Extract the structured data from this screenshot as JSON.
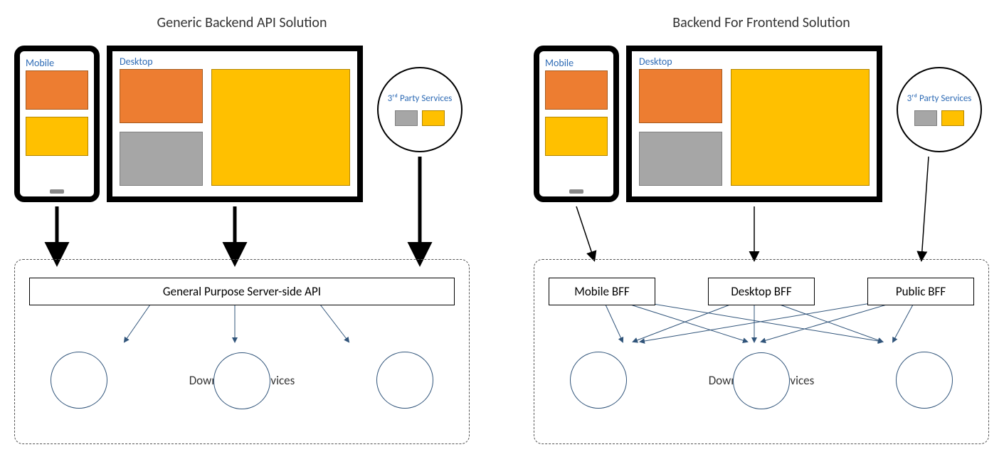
{
  "left": {
    "title": "Generic Backend API Solution",
    "mobile_label": "Mobile",
    "desktop_label": "Desktop",
    "third_party_label": "3ʳᵈ Party Services",
    "api_label": "General Purpose Server-side API",
    "downstream_label": "Downstream Services"
  },
  "right": {
    "title": "Backend For Frontend Solution",
    "mobile_label": "Mobile",
    "desktop_label": "Desktop",
    "third_party_label": "3ʳᵈ Party Services",
    "bff1": "Mobile BFF",
    "bff2": "Desktop BFF",
    "bff3": "Public BFF",
    "downstream_label": "Downstream Services"
  },
  "colors": {
    "orange": "#ed7d31",
    "yellow": "#ffc000",
    "gray": "#a6a6a6",
    "link_blue": "#2e6bb5",
    "arrow_thin": "#30547a"
  }
}
